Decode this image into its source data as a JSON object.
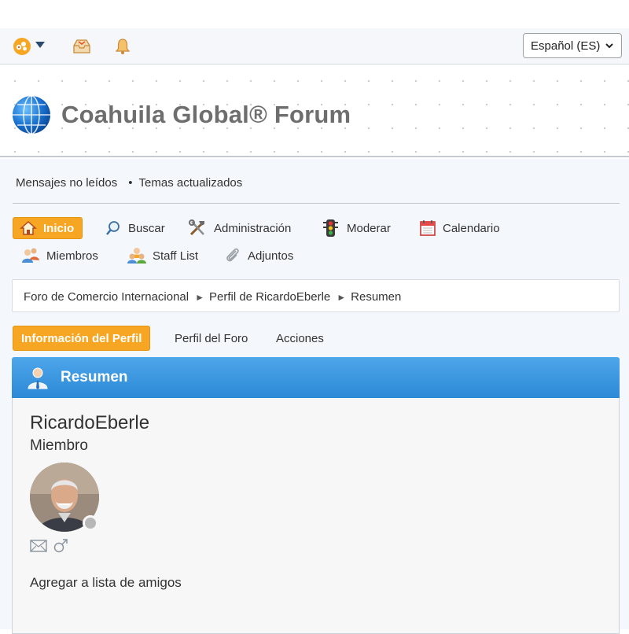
{
  "topbar": {
    "icons": [
      "forum-logo-icon",
      "chevron-down-icon",
      "inbox-icon",
      "bell-icon"
    ],
    "language_select": "Español (ES)"
  },
  "header": {
    "site_title": "Coahuila Global® Forum"
  },
  "quick_links": {
    "unread": "Mensajes no leídos",
    "separator": "•",
    "updated": "Temas actualizados"
  },
  "nav": {
    "home": "Inicio",
    "search": "Buscar",
    "admin": "Administración",
    "moderate": "Moderar",
    "calendar": "Calendario",
    "members": "Miembros",
    "staff": "Staff List",
    "attachments": "Adjuntos"
  },
  "breadcrumb": {
    "forum": "Foro de Comercio Internacional",
    "profile": "Perfil de RicardoEberle",
    "current": "Resumen",
    "arrow": "►"
  },
  "tabs": {
    "profile_info": "Información del Perfil",
    "forum_profile": "Perfil del Foro",
    "actions": "Acciones"
  },
  "panel": {
    "title": "Resumen",
    "username": "RicardoEberle",
    "role": "Miembro",
    "status": "offline",
    "add_friend": "Agregar a lista de amigos"
  },
  "colors": {
    "accent_orange": "#f6a623",
    "header_blue": "#3a96e0",
    "title_gray": "#6e6e6e"
  }
}
